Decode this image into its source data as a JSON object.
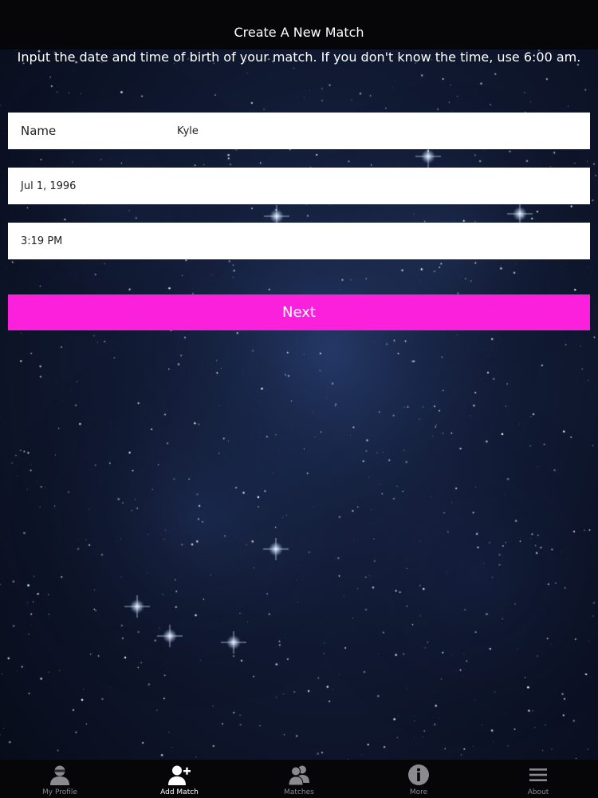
{
  "nav": {
    "title": "Create A New Match"
  },
  "instructions": "Input the date and time of birth of your match. If you don't know the time, use 6:00 am.",
  "form": {
    "name_label": "Name",
    "name_value": "Kyle",
    "date_value": "Jul 1, 1996",
    "time_value": "3:19 PM",
    "next_label": "Next"
  },
  "colors": {
    "accent": "#fb20dc",
    "bar_background": "#060608",
    "tab_inactive": "#8a8a8f",
    "tab_active": "#ffffff"
  },
  "tabs": [
    {
      "label": "My Profile",
      "icon": "profile-icon",
      "active": false
    },
    {
      "label": "Add Match",
      "icon": "add-user-icon",
      "active": true
    },
    {
      "label": "Matches",
      "icon": "group-icon",
      "active": false
    },
    {
      "label": "More",
      "icon": "info-icon",
      "active": false
    },
    {
      "label": "About",
      "icon": "menu-icon",
      "active": false
    }
  ]
}
